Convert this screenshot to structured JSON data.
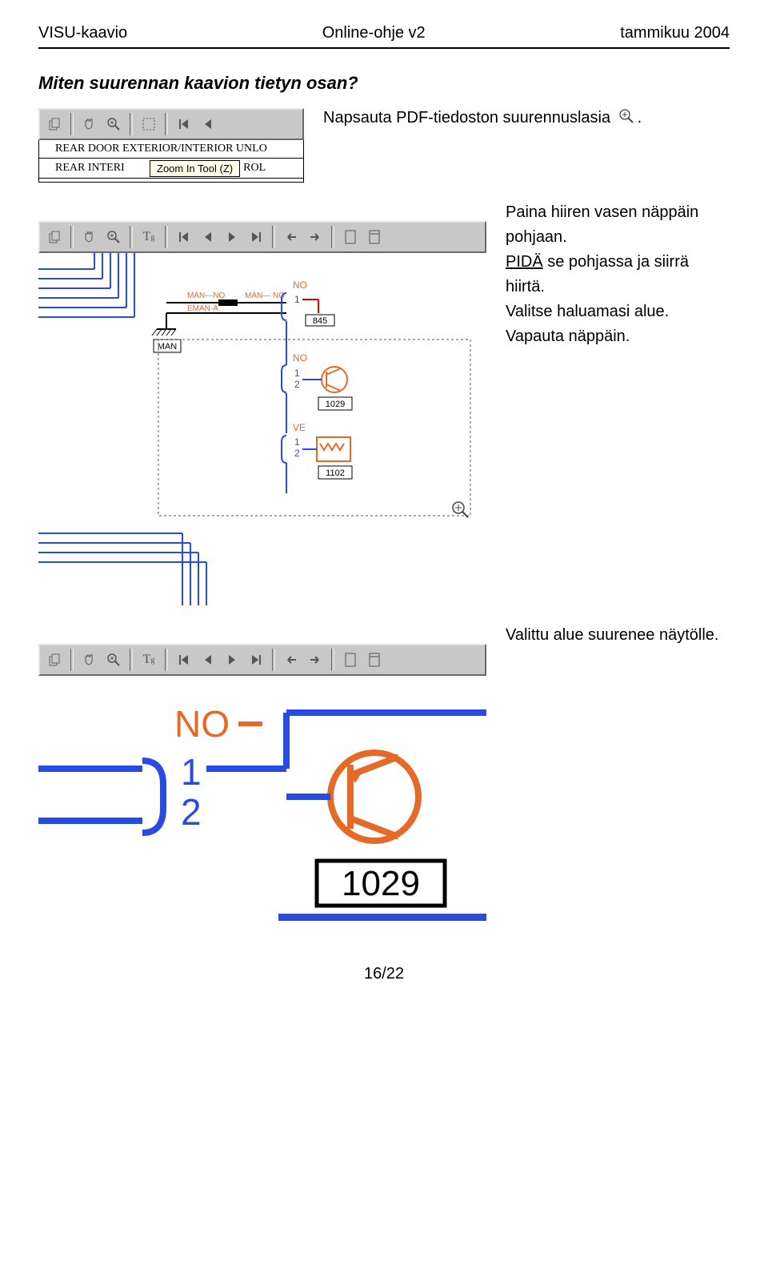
{
  "header": {
    "left": "VISU-kaavio",
    "center": "Online-ohje v2",
    "right": "tammikuu 2004"
  },
  "title": "Miten suurennan kaavion tietyn osan?",
  "intro": "Napsauta PDF-tiedoston suurennuslasia",
  "intro_suffix": ".",
  "toolbar1": {
    "rows": {
      "row1": "REAR DOOR EXTERIOR/INTERIOR UNLO",
      "row2_left": "REAR INTERI",
      "tooltip": "Zoom In Tool (Z)",
      "row2_right": "ROL"
    }
  },
  "body": {
    "p1": "Paina hiiren vasen näppäin pohjaan.",
    "p2_underlined": "PIDÄ",
    "p2_rest": " se pohjassa ja siirrä hiirtä.",
    "p3": "Valitse haluamasi alue.",
    "p4": "Vapauta näppäin."
  },
  "diagram": {
    "labels": {
      "man": "MAN",
      "no_top": "NO",
      "no_mid": "NO",
      "ve": "VE",
      "one": "1",
      "two": "2",
      "val845": "845",
      "val1029": "1029",
      "val1102": "1102",
      "trace1": "MAN—NO",
      "trace2": "EMAN-A",
      "trace3": "MAN— NO"
    }
  },
  "result_text": "Valittu alue suurenee näytölle.",
  "zoomed": {
    "no": "NO",
    "one": "1",
    "two": "2",
    "val": "1029"
  },
  "footer": "16/22"
}
